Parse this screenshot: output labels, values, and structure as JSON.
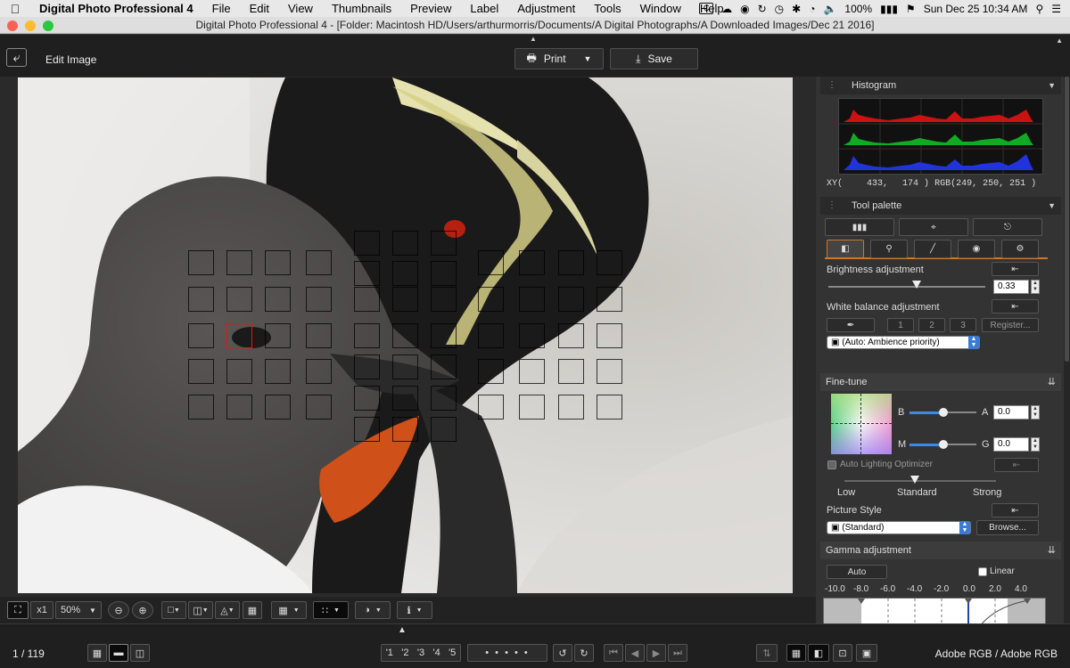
{
  "menubar": {
    "app_name": "Digital Photo Professional 4",
    "items": [
      "File",
      "Edit",
      "View",
      "Thumbnails",
      "Preview",
      "Label",
      "Adjustment",
      "Tools",
      "Window",
      "Help"
    ],
    "battery": "100%",
    "clock": "Sun Dec 25  10:34 AM"
  },
  "window": {
    "title": "Digital Photo Professional 4 - [Folder: Macintosh HD/Users/arthurmorris/Documents/A Digital Photographs/A Downloaded Images/Dec 21 2016]"
  },
  "toolbar": {
    "mode_label": "Edit Image",
    "print_label": "Print",
    "save_label": "Save"
  },
  "histogram": {
    "title": "Histogram",
    "xy_label": "XY(",
    "x": "433,",
    "y": "174 )",
    "rgb_label": "RGB(",
    "rgb_value": "249,  250,  251 )"
  },
  "tool_palette": {
    "title": "Tool palette",
    "brightness": {
      "label": "Brightness adjustment",
      "value": "0.33"
    },
    "white_balance": {
      "label": "White balance adjustment",
      "presets": [
        "1",
        "2",
        "3"
      ],
      "register_label": "Register...",
      "mode": "(Auto: Ambience priority)"
    }
  },
  "fine_tune": {
    "title": "Fine-tune",
    "b_label": "B",
    "a_label": "A",
    "a_value": "0.0",
    "m_label": "M",
    "g_label": "G",
    "g_value": "0.0",
    "alo_label": "Auto Lighting Optimizer",
    "alo_levels": [
      "Low",
      "Standard",
      "Strong"
    ],
    "picture_style_label": "Picture Style",
    "picture_style_value": "(Standard)",
    "browse_label": "Browse..."
  },
  "gamma": {
    "title": "Gamma adjustment",
    "auto_label": "Auto",
    "linear_label": "Linear",
    "scale": [
      "-10.0",
      "-8.0",
      "-6.0",
      "-4.0",
      "-2.0",
      "0.0",
      "2.0",
      "4.0"
    ]
  },
  "viewer_bar": {
    "zoom_factor": "x1",
    "zoom_level": "50%"
  },
  "status": {
    "image_counter": "1 / 119",
    "rating_marks": [
      "'1",
      "'2",
      "'3",
      "'4",
      "'5"
    ],
    "dots": "• • • • •",
    "color_space": "Adobe RGB / Adobe RGB"
  }
}
